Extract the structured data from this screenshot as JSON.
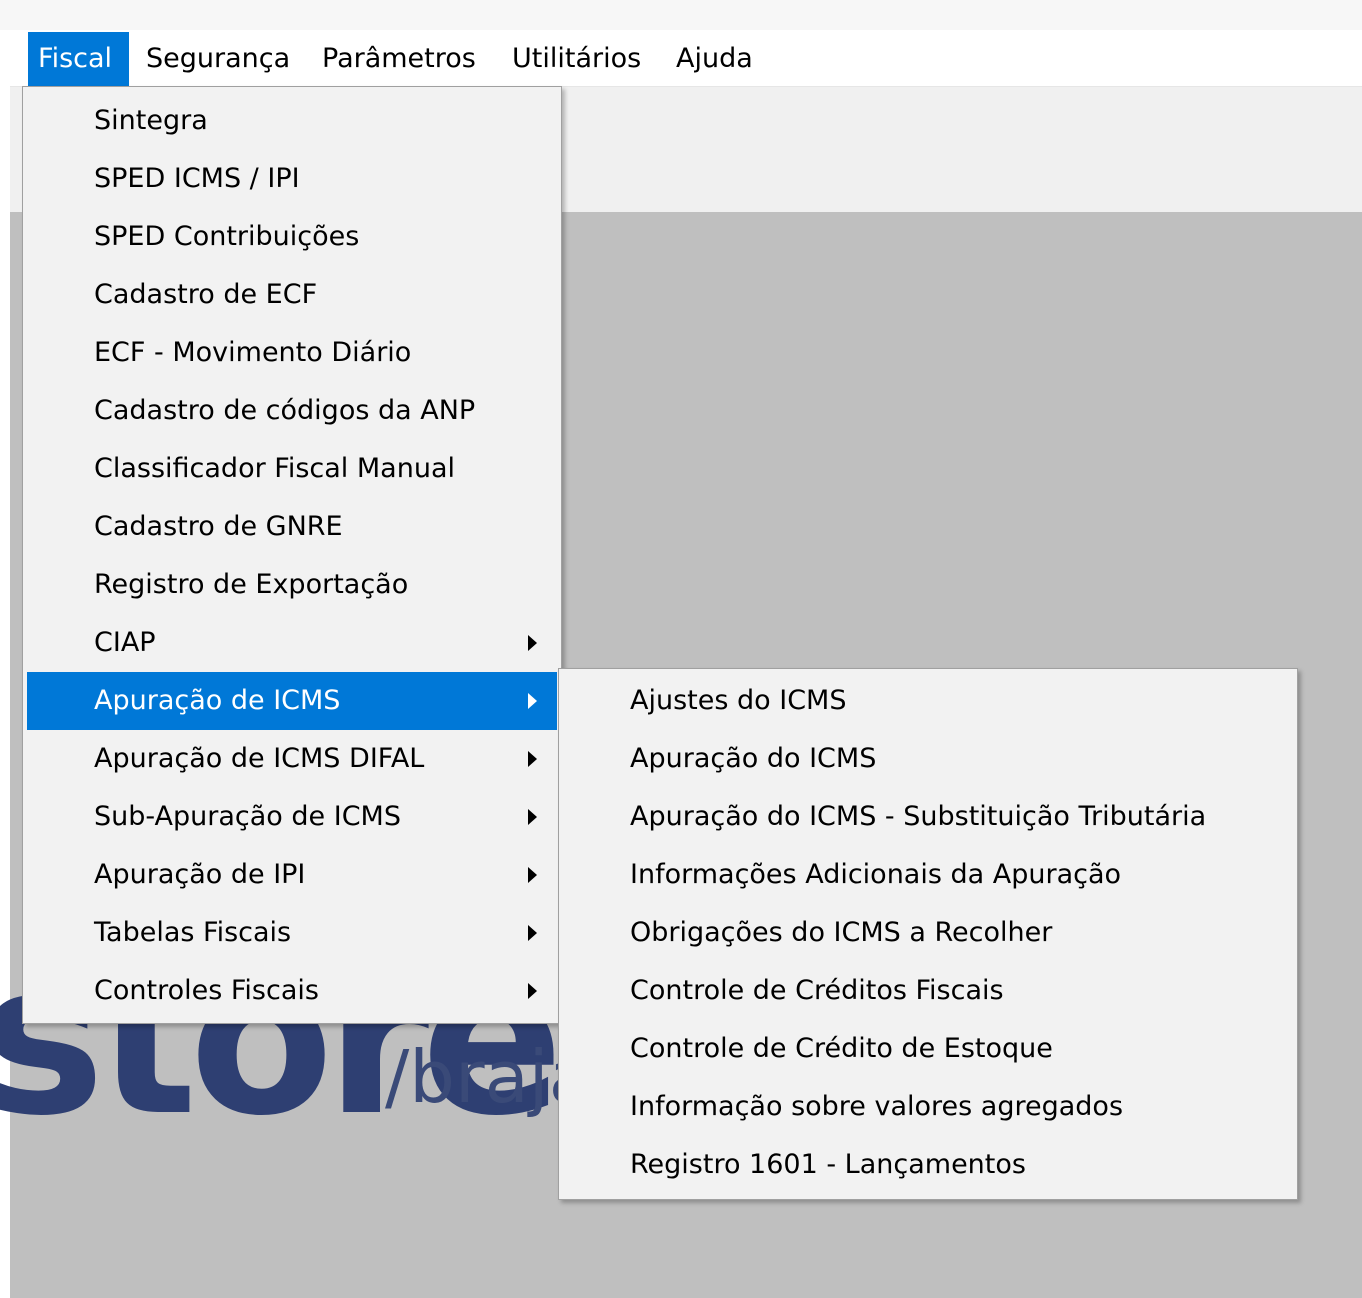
{
  "menubar": {
    "items": [
      {
        "label": "Fiscal",
        "active": true
      },
      {
        "label": "Segurança"
      },
      {
        "label": "Parâmetros"
      },
      {
        "label": "Utilitários"
      },
      {
        "label": "Ajuda"
      }
    ]
  },
  "background_logo": {
    "text": "stores",
    "sub": "/braja"
  },
  "fiscal_menu": {
    "items": [
      {
        "label": "Sintegra"
      },
      {
        "label": "SPED ICMS / IPI"
      },
      {
        "label": "SPED Contribuições"
      },
      {
        "label": "Cadastro de ECF"
      },
      {
        "label": "ECF - Movimento Diário"
      },
      {
        "label": "Cadastro de códigos da ANP"
      },
      {
        "label": "Classificador Fiscal Manual"
      },
      {
        "label": "Cadastro de GNRE"
      },
      {
        "label": "Registro de Exportação"
      },
      {
        "label": "CIAP",
        "submenu": true
      },
      {
        "label": "Apuração de ICMS",
        "submenu": true,
        "highlighted": true
      },
      {
        "label": "Apuração de ICMS DIFAL",
        "submenu": true
      },
      {
        "label": "Sub-Apuração de ICMS",
        "submenu": true
      },
      {
        "label": "Apuração de IPI",
        "submenu": true
      },
      {
        "label": "Tabelas Fiscais",
        "submenu": true
      },
      {
        "label": "Controles Fiscais",
        "submenu": true
      }
    ]
  },
  "apuracao_icms_submenu": {
    "items": [
      {
        "label": "Ajustes do ICMS"
      },
      {
        "label": "Apuração do ICMS"
      },
      {
        "label": "Apuração do ICMS - Substituição Tributária"
      },
      {
        "label": "Informações Adicionais da Apuração"
      },
      {
        "label": "Obrigações do ICMS a Recolher"
      },
      {
        "label": "Controle de Créditos Fiscais"
      },
      {
        "label": "Controle de Crédito de Estoque"
      },
      {
        "label": "Informação sobre valores agregados"
      },
      {
        "label": "Registro 1601 - Lançamentos"
      }
    ]
  },
  "colors": {
    "highlight": "#0078d7",
    "menu_bg": "#f2f2f2",
    "workspace_bg": "#bfbfbf",
    "logo": "#2e3f72"
  }
}
